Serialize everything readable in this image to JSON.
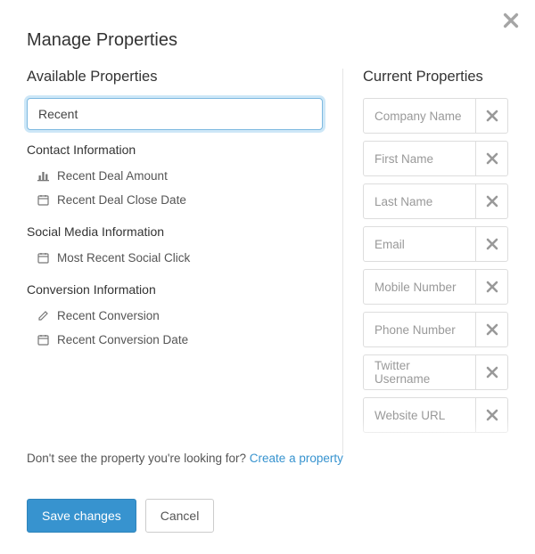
{
  "title": "Manage Properties",
  "available_heading": "Available Properties",
  "current_heading": "Current Properties",
  "search": {
    "value": "Recent"
  },
  "groups": [
    {
      "heading": "Contact Information",
      "items": [
        {
          "icon": "bar-chart",
          "label": "Recent Deal Amount"
        },
        {
          "icon": "calendar",
          "label": "Recent Deal Close Date"
        }
      ]
    },
    {
      "heading": "Social Media Information",
      "items": [
        {
          "icon": "calendar",
          "label": "Most Recent Social Click"
        }
      ]
    },
    {
      "heading": "Conversion Information",
      "items": [
        {
          "icon": "edit",
          "label": "Recent Conversion"
        },
        {
          "icon": "calendar",
          "label": "Recent Conversion Date"
        }
      ]
    }
  ],
  "current": [
    "Company Name",
    "First Name",
    "Last Name",
    "Email",
    "Mobile Number",
    "Phone Number",
    "Twitter Username",
    "Website URL"
  ],
  "help": {
    "text": "Don't see the property you're looking for? ",
    "link": "Create a property"
  },
  "buttons": {
    "save": "Save changes",
    "cancel": "Cancel"
  }
}
